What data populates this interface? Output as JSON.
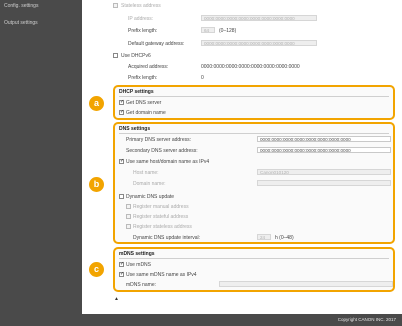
{
  "sidebar": {
    "items": [
      {
        "label": "Config. settings"
      },
      {
        "label": "Output settings"
      }
    ]
  },
  "ipv6": {
    "stateless_label": "Stateless address",
    "ip_address_label": "IP address:",
    "ip_address_value": "0000:0000:0000:0000:0000:0000:0000:0000",
    "prefix_label": "Prefix length:",
    "prefix_value": "64",
    "prefix_range": "(0–128)",
    "gateway_label": "Default gateway address:",
    "gateway_value": "0000:0000:0000:0000:0000:0000:0000:0000",
    "dhcpv6_label": "Use DHCPv6",
    "acquired_label": "Acquired address:",
    "acquired_value": "0000:0000:0000:0000:0000:0000:0000:0000",
    "acq_prefix_label": "Prefix length:",
    "acq_prefix_value": "0"
  },
  "dhcp": {
    "title": "DHCP settings",
    "get_dns_label": "Get DNS server",
    "get_domain_label": "Get domain name"
  },
  "dns": {
    "title": "DNS settings",
    "primary_label": "Primary DNS server address:",
    "primary_value": "0000:0000:0000:0000:0000:0000:0000:0000",
    "secondary_label": "Secondary DNS server address:",
    "secondary_value": "0000:0000:0000:0000:0000:0000:0000:0000",
    "same_host_label": "Use same host/domain name as IPv4",
    "host_label": "Host name:",
    "host_value": "Canon010120",
    "domain_label": "Domain name:",
    "domain_value": "",
    "dynamic_label": "Dynamic DNS update",
    "manual_label": "Register manual address",
    "stateful_label": "Register stateful address",
    "stateless_label": "Register stateless address",
    "interval_label": "Dynamic DNS update interval:",
    "interval_value": "24",
    "interval_range": "h (0–48)"
  },
  "mdns": {
    "title": "mDNS settings",
    "use_mdns_label": "Use mDNS",
    "same_name_label": "Use same mDNS name as IPv4",
    "name_label": "mDNS name:",
    "name_value": ""
  },
  "badges": {
    "a": "a",
    "b": "b",
    "c": "c"
  },
  "back_to_top": "▲",
  "footer": {
    "copyright": "Copyright CANON INC. 2017"
  },
  "colors": {
    "accent": "#f2a400",
    "sidebar": "#4a4a4a",
    "background": "#f4f4f4"
  }
}
